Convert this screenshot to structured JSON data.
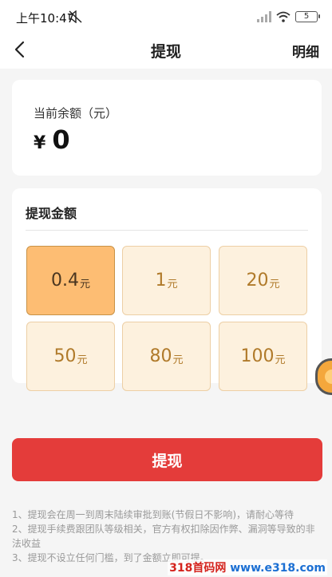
{
  "status_bar": {
    "time": "上午10:47",
    "battery": "5"
  },
  "nav": {
    "title": "提现",
    "right_label": "明细"
  },
  "balance": {
    "label": "当前余额（元）",
    "currency": "¥",
    "amount": "0"
  },
  "withdraw_amount": {
    "title": "提现金额",
    "unit": "元",
    "options": [
      {
        "value": "0.4",
        "selected": true
      },
      {
        "value": "1",
        "selected": false
      },
      {
        "value": "20",
        "selected": false
      },
      {
        "value": "50",
        "selected": false
      },
      {
        "value": "80",
        "selected": false
      },
      {
        "value": "100",
        "selected": false
      }
    ]
  },
  "submit_label": "提现",
  "notes": [
    "1、提现会在周一到周末陆续审批到账(节假日不影响)，请耐心等待",
    "2、提现手续费跟团队等级相关，官方有权扣除因作弊、漏洞等导致的非法收益",
    "3、提现不设立任何门槛，到了金额立即可提。"
  ],
  "watermark": {
    "brand": "318首码网",
    "url": "www.e318.com"
  },
  "colors": {
    "accent": "#e43c3a",
    "option_bg": "#fdf1de",
    "option_selected_bg": "#fdbd73",
    "option_text": "#b07a2a"
  }
}
